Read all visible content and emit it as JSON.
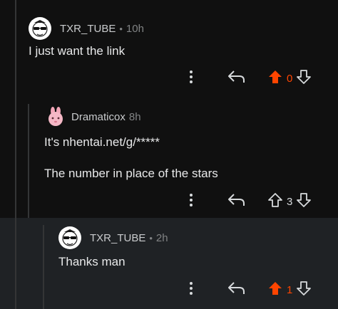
{
  "comments": [
    {
      "username": "TXR_TUBE",
      "separator": "•",
      "time": "10h",
      "lines": [
        "I just want the link"
      ],
      "score": "0",
      "upvoted": true
    },
    {
      "username": "Dramaticox",
      "time": "8h",
      "lines": [
        "It's nhentai.net/g/*****",
        "The number in place of the stars"
      ],
      "score": "3",
      "upvoted": false
    },
    {
      "username": "TXR_TUBE",
      "separator": "•",
      "time": "2h",
      "lines": [
        "Thanks man"
      ],
      "score": "1",
      "upvoted": true
    }
  ],
  "colors": {
    "background": "#101010",
    "highlight": "#1f2225",
    "upvote_active": "#ff4500",
    "text": "#e8e9ea",
    "muted": "#818384"
  },
  "icons": [
    "more-options-icon",
    "reply-icon",
    "upvote-icon",
    "downvote-icon"
  ]
}
